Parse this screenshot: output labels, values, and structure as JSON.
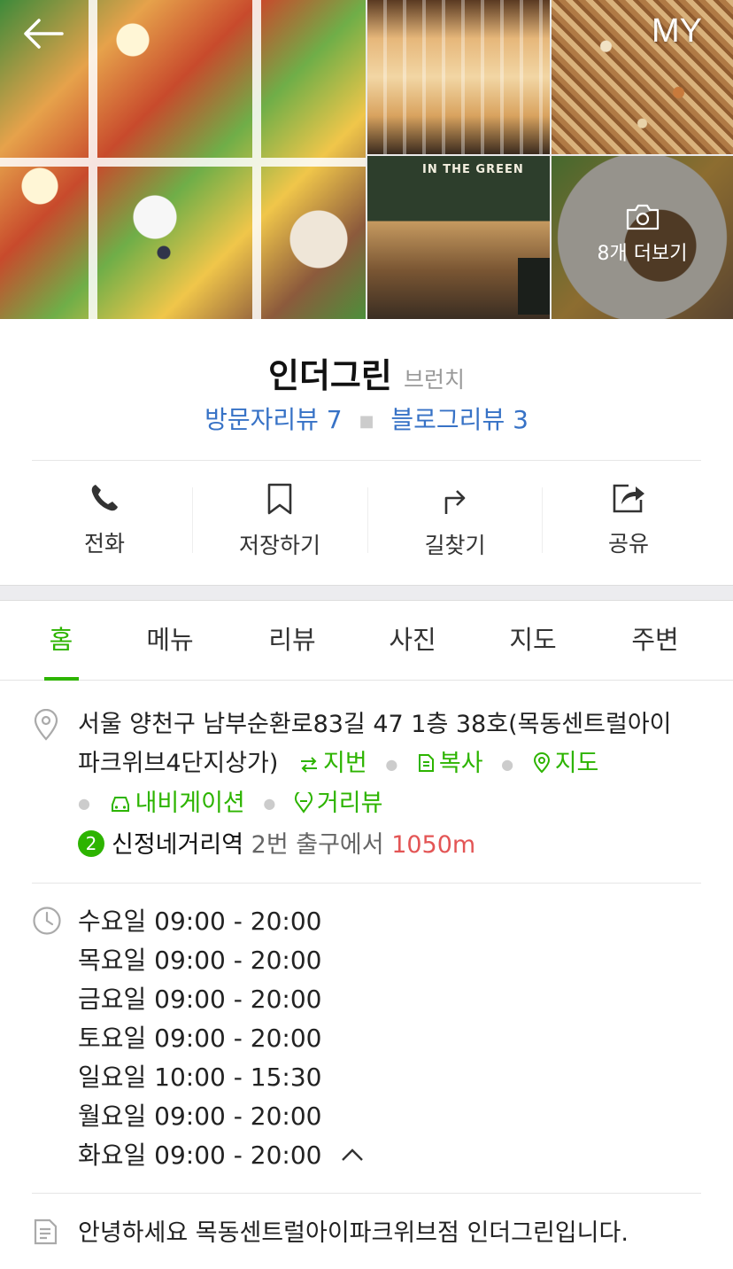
{
  "header": {
    "back_icon": "arrow-left-icon",
    "my_label": "MY",
    "more_photos_label": "8개 더보기",
    "store_sign_text": "IN THE GREEN"
  },
  "place": {
    "name": "인더그린",
    "category": "브런치",
    "visitor_reviews": "방문자리뷰 7",
    "blog_reviews": "블로그리뷰 3"
  },
  "actions": [
    {
      "label": "전화",
      "icon": "phone-icon"
    },
    {
      "label": "저장하기",
      "icon": "bookmark-icon"
    },
    {
      "label": "길찾기",
      "icon": "directions-icon"
    },
    {
      "label": "공유",
      "icon": "share-icon"
    }
  ],
  "tabs": [
    "홈",
    "메뉴",
    "리뷰",
    "사진",
    "지도",
    "주변"
  ],
  "active_tab": "홈",
  "address": {
    "line1": "서울 양천구 남부순환로83길 47 1층 38호(목동센트럴아이",
    "line2": "파크위브4단지상가)",
    "lot_label": "지번",
    "copy_label": "복사",
    "map_label": "지도",
    "navi_label": "내비게이션",
    "streetview_label": "거리뷰"
  },
  "station": {
    "line_number": "2",
    "name": "신정네거리역",
    "exit": "2번 출구에서",
    "distance": "1050m"
  },
  "hours": [
    "수요일 09:00 - 20:00",
    "목요일 09:00 - 20:00",
    "금요일 09:00 - 20:00",
    "토요일 09:00 - 20:00",
    "일요일 10:00 - 15:30",
    "월요일 09:00 - 20:00",
    "화요일 09:00 - 20:00"
  ],
  "description": "안녕하세요 목동센트럴아이파크위브점 인더그린입니다.",
  "colors": {
    "accent_green": "#2db400",
    "review_blue": "#3772c6",
    "distance_red": "#e35555"
  }
}
